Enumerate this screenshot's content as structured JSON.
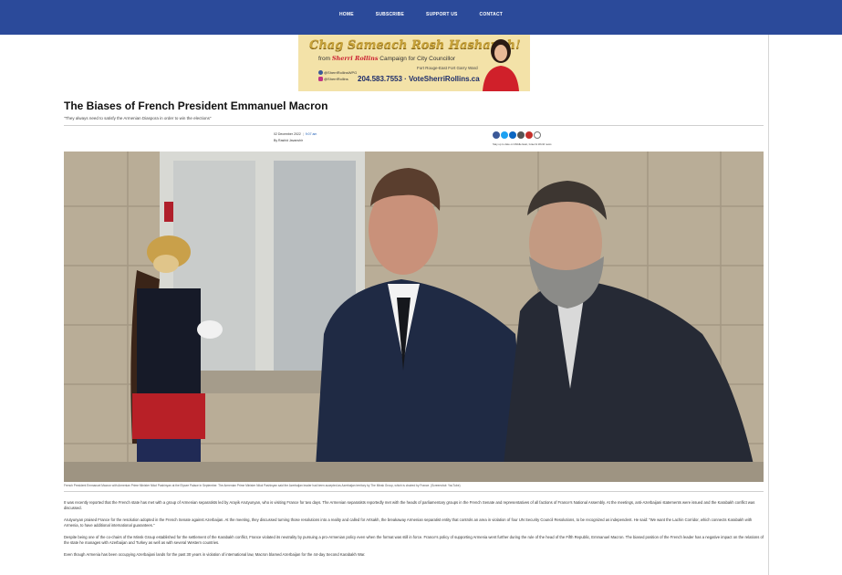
{
  "nav": {
    "items": [
      "HOME",
      "SUBSCRIBE",
      "SUPPORT US",
      "CONTACT"
    ]
  },
  "ad": {
    "headline": "Chag Sameach Rosh Hashanah!",
    "from_prefix": "from",
    "candidate": "Sherri Rollins",
    "campaign": "Campaign for City Councillor",
    "ward_line1": "Fort Rouge-East Fort Garry Ward",
    "social_1": "@SherriRollinsWPG",
    "social_2": "@SherriRollins",
    "phone_and_site": "204.583.7553 · VoteSherriRollins.ca"
  },
  "article": {
    "title": "The Biases of French President Emmanuel Macron",
    "subtitle": "\"They always need to satisfy the Armenian Diaspora in order to win the elections\"",
    "date": "02 December 2022",
    "time": "9:07 am",
    "byline": "By Rashid Javanshir",
    "share_caption": "Stay up to date on Middle East, Israel & World news",
    "photo_caption": "French President Emmanuel Macron with Armenian Prime Minister Nikol Pashinyan at the Elysee Palace in September. The Armenian Prime Minister Nikol Pashinyan said the Azerbaijan leader had been accepted as Azerbaijan territory by The Minsk Group, which is chaired by France. (Screenshot: YouTube)",
    "paragraphs": [
      "It was recently reported that the French state has met with a group of Armenian separatists led by Arayik Arutyunyan, who is visiting France for two days. The Armenian separatists reportedly met with the heads of parliamentary groups in the French Senate and representatives of all factions of France's National Assembly. At the meetings, anti-Azerbaijani statements were issued and the Karabakh conflict was discussed.",
      "Arutyunyan praised France for the resolution adopted in the French Senate against Azerbaijan. At the meeting, they discussed turning those resolutions into a reality and called for Artsakh, the breakaway Armenian separatist entity that controls an area in violation of four UN Security Council Resolutions, to be recognized as independent. He said: \"We want the Lachin Corridor, which connects Karabakh with Armenia, to have additional international guarantees.\"",
      "Despite being one of the co-chairs of the Minsk Group established for the settlement of the Karabakh conflict, France violated its neutrality by pursuing a pro-Armenian policy even when the format was still in force. France's policy of supporting Armenia went further during the rule of the head of the Fifth Republic, Emmanuel Macron. The biased position of the French leader has a negative impact on the relations of the state he manages with Azerbaijan and Turkey as well as with several Western countries.",
      "Even though Armenia has been occupying Azerbaijani lands for the past 30 years in violation of international law, Macron blamed Azerbaijan for the 44-day Second Karabakh War."
    ]
  },
  "share_icons": [
    {
      "name": "facebook-share-icon",
      "color": "#3b5998"
    },
    {
      "name": "twitter-share-icon",
      "color": "#1da1f2"
    },
    {
      "name": "linkedin-share-icon",
      "color": "#0a66c2"
    },
    {
      "name": "email-share-icon",
      "color": "#555555"
    },
    {
      "name": "print-share-icon",
      "color": "#c4302b"
    },
    {
      "name": "share-icon",
      "color": "#777777"
    }
  ],
  "colors": {
    "nav_bg": "#2b4a9a",
    "link": "#1a5bb5"
  }
}
